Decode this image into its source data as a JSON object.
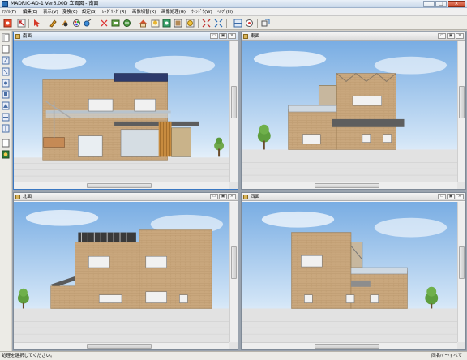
{
  "window": {
    "title": "MADRIC-AD-1 Ver6.00D 立面図 - 南面",
    "buttons": {
      "minimize": "_",
      "maximize": "□",
      "close": "×"
    }
  },
  "menu": [
    "ﾌｧｲﾙ(F)",
    "編集(E)",
    "表示(V)",
    "変換(C)",
    "設定(S)",
    "ﾚﾝﾀﾞﾘﾝｸﾞ(R)",
    "画像切替(K)",
    "画像処理(G)",
    "ｳｨﾝﾄﾞｳ(W)",
    "ﾍﾙﾌﾟ(H)"
  ],
  "toolbar": {
    "icons": [
      "open-icon",
      "pointer-icon",
      "paint-icon",
      "object-icon",
      "color-icon",
      "link-icon",
      "rotate-icon",
      "refresh-icon",
      "render-icon",
      "house-icon",
      "tree-icon",
      "light-icon",
      "image-icon",
      "sun-icon",
      "expand-icon",
      "shrink-icon",
      "grid-icon",
      "target-icon",
      "zoom-icon"
    ]
  },
  "views": [
    {
      "label": "南面",
      "side": "south"
    },
    {
      "label": "東面",
      "side": "east"
    },
    {
      "label": "北面",
      "side": "north"
    },
    {
      "label": "西面",
      "side": "west"
    }
  ],
  "view_buttons": {
    "min": "▭",
    "restore": "▣",
    "close": "×"
  },
  "status": {
    "message": "処理を選択してください。",
    "right": "同名ﾊﾟｰﾂすべて"
  },
  "colors": {
    "brick": "#c9a77d",
    "sky_top": "#7fb2e6",
    "sky_bottom": "#ffffff",
    "ground": "#dcdcdc",
    "active_border": "#3b78c2"
  }
}
